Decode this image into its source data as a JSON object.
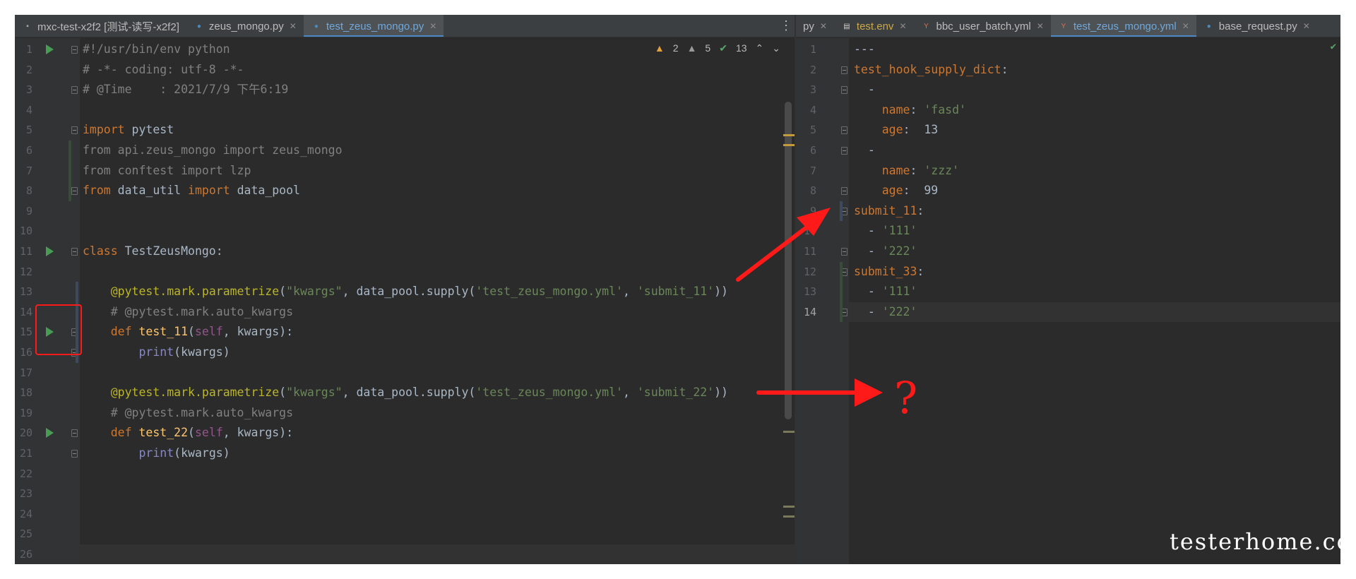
{
  "left_tabs": [
    {
      "label": "mxc-test-x2f2 [测试-读写-x2f2]",
      "icon": "project-icon",
      "active": false
    },
    {
      "label": "zeus_mongo.py",
      "icon": "python-icon",
      "active": false
    },
    {
      "label": "test_zeus_mongo.py",
      "icon": "python-icon",
      "active": true
    }
  ],
  "right_tabs": [
    {
      "label": "py",
      "icon": "",
      "active": false
    },
    {
      "label": "test.env",
      "icon": "file-icon",
      "active": false
    },
    {
      "label": "bbc_user_batch.yml",
      "icon": "yml-icon",
      "active": false
    },
    {
      "label": "test_zeus_mongo.yml",
      "icon": "yml-icon",
      "active": true
    },
    {
      "label": "base_request.py",
      "icon": "python-icon",
      "active": false
    }
  ],
  "inspections": {
    "warnings": "2",
    "weak_warnings": "5",
    "ok": "13"
  },
  "left_editor": {
    "line_numbers": [
      "1",
      "2",
      "3",
      "4",
      "5",
      "6",
      "7",
      "8",
      "9",
      "10",
      "11",
      "12",
      "13",
      "14",
      "15",
      "16",
      "17",
      "18",
      "19",
      "20",
      "21",
      "22",
      "23",
      "24",
      "25",
      "26"
    ],
    "lines": [
      [
        {
          "t": "#!/usr/bin/env python",
          "c": "cm"
        }
      ],
      [
        {
          "t": "# -*- coding: utf-8 -*-",
          "c": "cm"
        }
      ],
      [
        {
          "t": "# @Time    : 2021/7/9 下午6:19",
          "c": "cm"
        }
      ],
      [],
      [
        {
          "t": "import",
          "c": "kw"
        },
        {
          "t": " pytest",
          "c": ""
        }
      ],
      [
        {
          "t": "from api.zeus_mongo import zeus_mongo",
          "c": "cm"
        }
      ],
      [
        {
          "t": "from conftest import lzp",
          "c": "cm"
        }
      ],
      [
        {
          "t": "from",
          "c": "kw"
        },
        {
          "t": " data_util ",
          "c": ""
        },
        {
          "t": "import",
          "c": "kw"
        },
        {
          "t": " data_pool",
          "c": ""
        }
      ],
      [],
      [],
      [
        {
          "t": "class",
          "c": "kw"
        },
        {
          "t": " TestZeusMongo:",
          "c": ""
        }
      ],
      [],
      [
        {
          "t": "    ",
          "c": ""
        },
        {
          "t": "@pytest.mark.parametrize",
          "c": "dc"
        },
        {
          "t": "(",
          "c": ""
        },
        {
          "t": "\"kwargs\"",
          "c": "st"
        },
        {
          "t": ", data_pool.supply(",
          "c": ""
        },
        {
          "t": "'test_zeus_mongo.yml'",
          "c": "st"
        },
        {
          "t": ", ",
          "c": ""
        },
        {
          "t": "'submit_11'",
          "c": "st"
        },
        {
          "t": "))",
          "c": ""
        }
      ],
      [
        {
          "t": "    # @pytest.mark.auto_kwargs",
          "c": "cm"
        }
      ],
      [
        {
          "t": "    ",
          "c": ""
        },
        {
          "t": "def",
          "c": "kw"
        },
        {
          "t": " ",
          "c": ""
        },
        {
          "t": "test_11",
          "c": "fn"
        },
        {
          "t": "(",
          "c": ""
        },
        {
          "t": "self",
          "c": "sf"
        },
        {
          "t": ", kwargs):",
          "c": ""
        }
      ],
      [
        {
          "t": "        ",
          "c": ""
        },
        {
          "t": "print",
          "c": "pr"
        },
        {
          "t": "(kwargs)",
          "c": ""
        }
      ],
      [],
      [
        {
          "t": "    ",
          "c": ""
        },
        {
          "t": "@pytest.mark.parametrize",
          "c": "dc"
        },
        {
          "t": "(",
          "c": ""
        },
        {
          "t": "\"kwargs\"",
          "c": "st"
        },
        {
          "t": ", data_pool.supply(",
          "c": ""
        },
        {
          "t": "'test_zeus_mongo.yml'",
          "c": "st"
        },
        {
          "t": ", ",
          "c": ""
        },
        {
          "t": "'submit_22'",
          "c": "st"
        },
        {
          "t": "))",
          "c": ""
        }
      ],
      [
        {
          "t": "    # @pytest.mark.auto_kwargs",
          "c": "cm"
        }
      ],
      [
        {
          "t": "    ",
          "c": ""
        },
        {
          "t": "def",
          "c": "kw"
        },
        {
          "t": " ",
          "c": ""
        },
        {
          "t": "test_22",
          "c": "fn"
        },
        {
          "t": "(",
          "c": ""
        },
        {
          "t": "self",
          "c": "sf"
        },
        {
          "t": ", kwargs):",
          "c": ""
        }
      ],
      [
        {
          "t": "        ",
          "c": ""
        },
        {
          "t": "print",
          "c": "pr"
        },
        {
          "t": "(kwargs)",
          "c": ""
        }
      ],
      [],
      [],
      [],
      [],
      []
    ]
  },
  "right_editor": {
    "line_numbers": [
      "1",
      "2",
      "3",
      "4",
      "5",
      "6",
      "7",
      "8",
      "9",
      "10",
      "11",
      "12",
      "13",
      "14"
    ],
    "lines": [
      [
        {
          "t": "---",
          "c": ""
        }
      ],
      [
        {
          "t": "test_hook_supply_dict",
          "c": "yk"
        },
        {
          "t": ":",
          "c": ""
        }
      ],
      [
        {
          "t": "  -",
          "c": ""
        }
      ],
      [
        {
          "t": "    ",
          "c": ""
        },
        {
          "t": "name",
          "c": "yk"
        },
        {
          "t": ": ",
          "c": ""
        },
        {
          "t": "'fasd'",
          "c": "st"
        }
      ],
      [
        {
          "t": "    ",
          "c": ""
        },
        {
          "t": "age",
          "c": "yk"
        },
        {
          "t": ":  13",
          "c": ""
        }
      ],
      [
        {
          "t": "  -",
          "c": ""
        }
      ],
      [
        {
          "t": "    ",
          "c": ""
        },
        {
          "t": "name",
          "c": "yk"
        },
        {
          "t": ": ",
          "c": ""
        },
        {
          "t": "'zzz'",
          "c": "st"
        }
      ],
      [
        {
          "t": "    ",
          "c": ""
        },
        {
          "t": "age",
          "c": "yk"
        },
        {
          "t": ":  99",
          "c": ""
        }
      ],
      [
        {
          "t": "submit_11",
          "c": "yk"
        },
        {
          "t": ":",
          "c": ""
        }
      ],
      [
        {
          "t": "  - ",
          "c": ""
        },
        {
          "t": "'111'",
          "c": "st"
        }
      ],
      [
        {
          "t": "  - ",
          "c": ""
        },
        {
          "t": "'222'",
          "c": "st"
        }
      ],
      [
        {
          "t": "submit_33",
          "c": "yk"
        },
        {
          "t": ":",
          "c": ""
        }
      ],
      [
        {
          "t": "  - ",
          "c": ""
        },
        {
          "t": "'111'",
          "c": "st"
        }
      ],
      [
        {
          "t": "  - ",
          "c": ""
        },
        {
          "t": "'222'",
          "c": "st"
        }
      ]
    ]
  },
  "annotation": {
    "question_mark": "?"
  },
  "watermark": "testerhome.com"
}
